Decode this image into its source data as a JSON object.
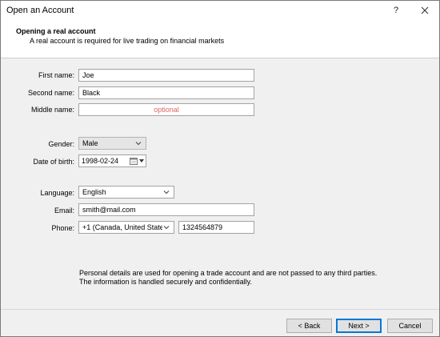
{
  "window": {
    "title": "Open an Account",
    "help_glyph": "?",
    "close_glyph": "✕"
  },
  "header": {
    "title": "Opening a real account",
    "subtitle": "A real account is required for live trading on financial markets"
  },
  "form": {
    "first_name": {
      "label": "First name:",
      "value": "Joe"
    },
    "second_name": {
      "label": "Second name:",
      "value": "Black"
    },
    "middle_name": {
      "label": "Middle name:",
      "value": "",
      "placeholder": "optional"
    },
    "gender": {
      "label": "Gender:",
      "value": "Male"
    },
    "date_of_birth": {
      "label": "Date of birth:",
      "value": "1998-02-24"
    },
    "language": {
      "label": "Language:",
      "value": "English"
    },
    "email": {
      "label": "Email:",
      "value": "smith@mail.com"
    },
    "phone": {
      "label": "Phone:",
      "country_code": "+1 (Canada, United State",
      "number": "1324564879"
    }
  },
  "notice": {
    "line1": "Personal details are used for opening a trade account and are not passed to any third parties.",
    "line2": "The information is handled securely and confidentially."
  },
  "buttons": {
    "back": "< Back",
    "next": "Next >",
    "cancel": "Cancel"
  },
  "colors": {
    "placeholder": "#e26262",
    "focus_border": "#0078d7"
  }
}
